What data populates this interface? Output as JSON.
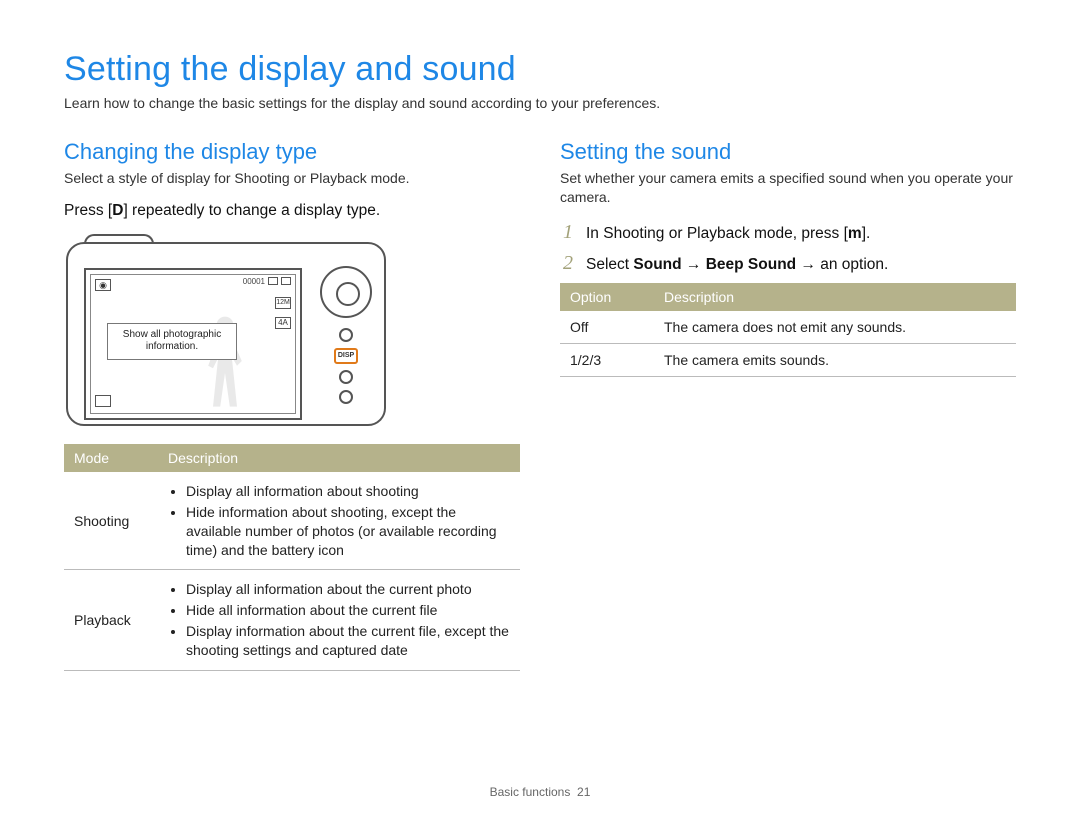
{
  "page": {
    "title": "Setting the display and sound",
    "intro": "Learn how to change the basic settings for the display and sound according to your preferences.",
    "footer_section": "Basic functions",
    "footer_page": "21"
  },
  "left": {
    "heading": "Changing the display type",
    "desc": "Select a style of display for Shooting or Playback mode.",
    "instruction_prefix": "Press [",
    "instruction_key": "D",
    "instruction_suffix": "] repeatedly to change a display type.",
    "camera": {
      "counter": "00001",
      "size_badge": "12M",
      "flash_badge": "4A",
      "tooltip_line1": "Show all photographic",
      "tooltip_line2": "information.",
      "disp_label": "DISP"
    },
    "table": {
      "headers": {
        "mode": "Mode",
        "desc": "Description"
      },
      "rows": [
        {
          "mode": "Shooting",
          "bullets": [
            "Display all information about shooting",
            "Hide information about shooting, except the available number of photos (or available recording time) and the battery icon"
          ]
        },
        {
          "mode": "Playback",
          "bullets": [
            "Display all information about the current photo",
            "Hide all information about the current file",
            "Display information about the current file, except the shooting settings and captured date"
          ]
        }
      ]
    }
  },
  "right": {
    "heading": "Setting the sound",
    "desc": "Set whether your camera emits a specified sound when you operate your camera.",
    "steps": [
      {
        "num": "1",
        "text_prefix": "In Shooting or Playback mode, press [",
        "text_key": "m",
        "text_suffix": "]."
      },
      {
        "num": "2",
        "text_prefix": "Select ",
        "path": "Sound → Beep Sound →",
        "text_suffix": " an option."
      }
    ],
    "table": {
      "headers": {
        "option": "Option",
        "desc": "Description"
      },
      "rows": [
        {
          "option": "Off",
          "desc": "The camera does not emit any sounds."
        },
        {
          "option": "1/2/3",
          "desc": "The camera emits sounds."
        }
      ]
    }
  }
}
